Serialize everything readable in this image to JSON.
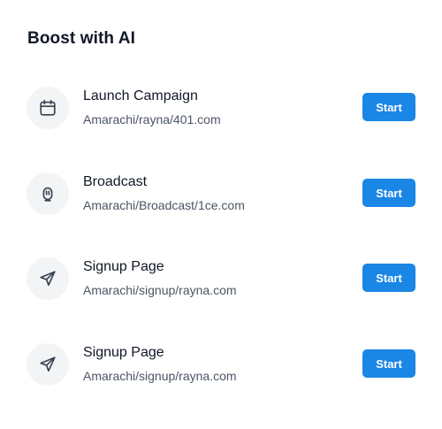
{
  "header": {
    "title": "Boost with AI"
  },
  "items": [
    {
      "icon": "calendar-icon",
      "title": "Launch Campaign",
      "subtitle": "Amarachi/rayna/401.com",
      "button": "Start"
    },
    {
      "icon": "microphone-icon",
      "title": "Broadcast",
      "subtitle": "Amarachi/Broadcast/1ce.com",
      "button": "Start"
    },
    {
      "icon": "send-icon",
      "title": "Signup Page",
      "subtitle": "Amarachi/signup/rayna.com",
      "button": "Start"
    },
    {
      "icon": "send-icon",
      "title": "Signup Page",
      "subtitle": "Amarachi/signup/rayna.com",
      "button": "Start"
    }
  ],
  "colors": {
    "accent": "#1a86e6",
    "icon_bg": "#f3f4f6",
    "icon_stroke": "#374151"
  }
}
